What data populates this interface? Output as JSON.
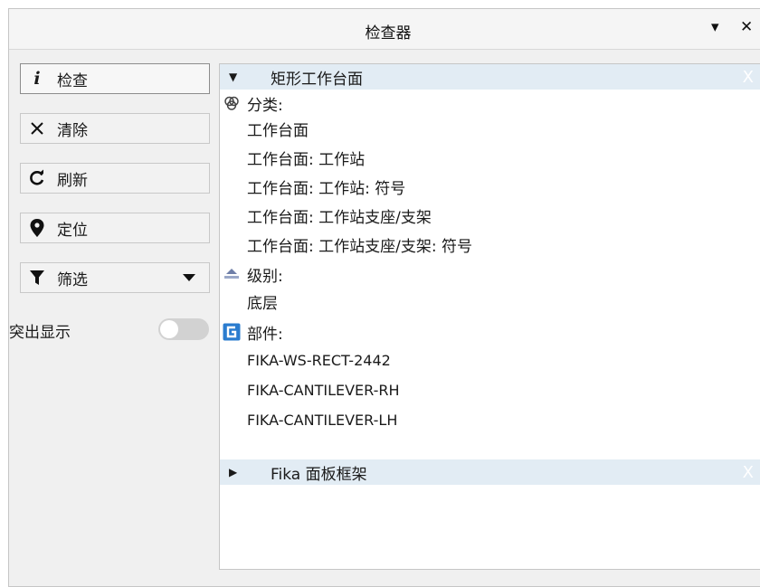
{
  "window": {
    "title": "检查器",
    "collapse_glyph": "▾",
    "close_glyph": "✕"
  },
  "toolbar": {
    "inspect": {
      "icon": "info-icon",
      "label": "检查"
    },
    "clear": {
      "icon": "close-icon",
      "label": "清除"
    },
    "refresh": {
      "icon": "refresh-icon",
      "label": "刷新"
    },
    "locate": {
      "icon": "location-pin-icon",
      "label": "定位"
    },
    "filter": {
      "icon": "funnel-icon",
      "label": "筛选"
    }
  },
  "highlight": {
    "label": "突出显示",
    "enabled": false
  },
  "groups": [
    {
      "title": "矩形工作台面",
      "expanded": true,
      "expand_glyph": "▼",
      "close_glyph": "X",
      "sections": [
        {
          "icon": "category-icon",
          "label": "分类:",
          "items": [
            "工作台面",
            "工作台面: 工作站",
            "工作台面: 工作站: 符号",
            "工作台面: 工作站支座/支架",
            "工作台面: 工作站支座/支架: 符号"
          ]
        },
        {
          "icon": "level-icon",
          "label": "级别:",
          "items": [
            "底层"
          ]
        },
        {
          "icon": "part-icon",
          "label": "部件:",
          "items": [
            "FIKA-WS-RECT-2442",
            "FIKA-CANTILEVER-RH",
            "FIKA-CANTILEVER-LH"
          ]
        }
      ]
    },
    {
      "title": "Fika 面板框架",
      "expanded": false,
      "expand_glyph": "▶",
      "close_glyph": "X"
    }
  ],
  "colors": {
    "group_header_bg": "#e2ecf4",
    "panel_bg": "#f0f0f0",
    "part_icon": "#2a7ccf"
  }
}
